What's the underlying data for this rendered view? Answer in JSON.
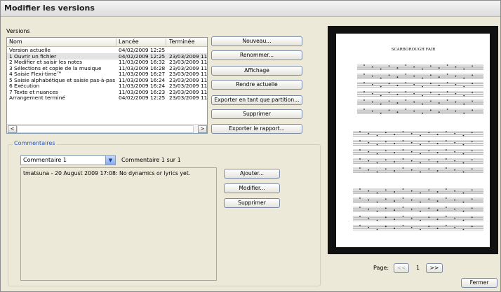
{
  "window": {
    "title": "Modifier les versions"
  },
  "versions": {
    "label": "Versions",
    "columns": [
      "Nom",
      "Lancée",
      "Terminée"
    ],
    "rows": [
      {
        "name": "Version actuelle",
        "started": "04/02/2009 12:25",
        "finished": ""
      },
      {
        "name": "1 Ouvrir un fichier",
        "started": "04/02/2009 12:25",
        "finished": "23/03/2009 11:"
      },
      {
        "name": "2 Modifier et saisir les notes",
        "started": "11/03/2009 16:32",
        "finished": "23/03/2009 11:"
      },
      {
        "name": "3 Sélections et copie de la musique",
        "started": "11/03/2009 16:28",
        "finished": "23/03/2009 11:"
      },
      {
        "name": "4 Saisie Flexi-time™",
        "started": "11/03/2009 16:27",
        "finished": "23/03/2009 11:"
      },
      {
        "name": "5 Saisie alphabétique et saisie pas-à-pas",
        "started": "11/03/2009 16:24",
        "finished": "23/03/2009 11:"
      },
      {
        "name": "6 Exécution",
        "started": "11/03/2009 16:24",
        "finished": "23/03/2009 11:"
      },
      {
        "name": "7 Texte et nuances",
        "started": "11/03/2009 16:23",
        "finished": "23/03/2009 11:"
      },
      {
        "name": "Arrangement terminé",
        "started": "04/02/2009 12:25",
        "finished": "23/03/2009 11:"
      }
    ],
    "selected_index": 1
  },
  "buttons": {
    "nouveau": "Nouveau...",
    "renommer": "Renommer...",
    "affichage": "Affichage",
    "rendre_actuelle": "Rendre actuelle",
    "exporter_partition": "Exporter en tant que partition...",
    "supprimer": "Supprimer",
    "exporter_rapport": "Exporter le rapport...",
    "fermer": "Fermer"
  },
  "comments": {
    "group_label": "Commentaires",
    "selected": "Commentaire 1",
    "count_text": "Commentaire 1 sur 1",
    "text": "tmatsuna - 20 August 2009 17:08: No dynamics or lyrics yet.",
    "buttons": {
      "ajouter": "Ajouter...",
      "modifier": "Modifier...",
      "supprimer": "Supprimer"
    }
  },
  "preview": {
    "score_title": "SCARBOROUGH FAIR",
    "page_label": "Page:",
    "page_number": "1",
    "prev_label": "<<",
    "next_label": ">>"
  },
  "colors": {
    "accent": "#2256c4",
    "preview_bg": "#111111"
  }
}
